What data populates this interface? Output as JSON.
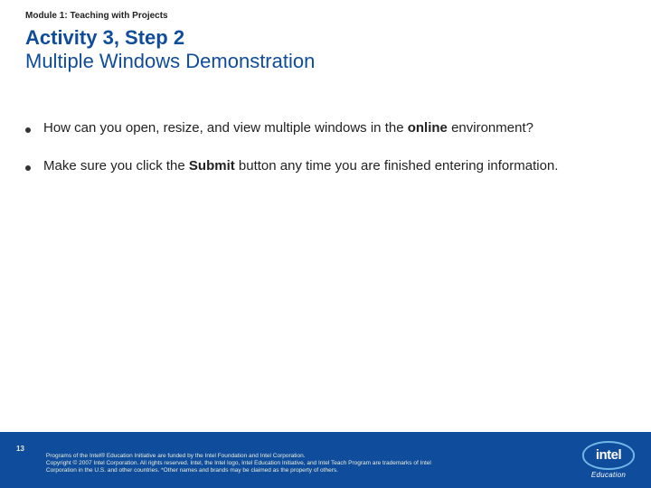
{
  "header": {
    "module": "Module 1: Teaching with Projects",
    "title": "Activity 3, Step 2",
    "subtitle": "Multiple Windows Demonstration"
  },
  "bullets": [
    {
      "pre": "How can you open, resize, and view multiple windows in the",
      "bold": "online",
      "post": "environment?"
    },
    {
      "pre": "Make sure you click the ",
      "bold": "Submit",
      "post": " button any time you are finished entering information."
    }
  ],
  "footer": {
    "slide_number": "13",
    "legal_line1": "Programs of the Intel® Education Initiative are funded by the Intel Foundation and Intel Corporation.",
    "legal_line2": "Copyright © 2007 Intel Corporation. All rights reserved. Intel, the Intel logo, Intel Education Initiative, and Intel Teach Program are trademarks of Intel Corporation in the U.S. and other countries. *Other names and brands may be claimed as the property of others."
  },
  "logo": {
    "brand": "intel",
    "sub": "Education"
  }
}
